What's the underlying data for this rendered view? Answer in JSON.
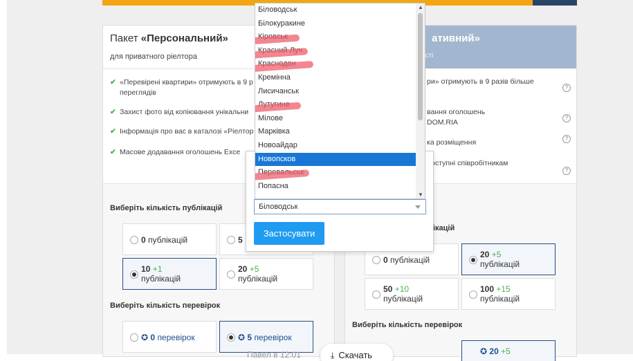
{
  "left_card": {
    "title_prefix": "Пакет ",
    "title_bold": "«Персональний»",
    "subtitle": "для приватного ріелтора",
    "features": [
      "«Перевірені квартири» отримують в 9 р",
      "переглядів",
      "Захист фото від копіювання унікальни",
      "Інформація про вас в каталозі «Ріелтор",
      "Масове додавання оголошень Exce"
    ],
    "publications_label": "Виберіть кількість публікацій",
    "publication_options": [
      {
        "num": "0",
        "text": "публікацій",
        "plus": ""
      },
      {
        "num": "5",
        "text": "",
        "plus": ""
      },
      {
        "num": "10",
        "text": "публікацій",
        "plus": "+1"
      },
      {
        "num": "20",
        "text": "публікацій",
        "plus": "+5"
      }
    ],
    "checks_label": "Виберіть кількість перевірок",
    "check_options": [
      {
        "num": "0",
        "text": "перевірок"
      },
      {
        "num": "5",
        "text": "перевірок"
      }
    ]
  },
  "right_card": {
    "title": "ативний»",
    "subtitle": "ості",
    "features": [
      "ри» отримують в 9 разів більше",
      "вання оголошень",
      "DOM.RIA",
      "ка розміщення",
      "доступні співробітникам"
    ],
    "publications_label": "лікацій",
    "publication_options": [
      {
        "num": "0",
        "text": "публікацій",
        "plus": ""
      },
      {
        "num": "20",
        "text": "публікацій",
        "plus": "+5"
      },
      {
        "num": "50",
        "text": "публікацій",
        "plus": "+10"
      },
      {
        "num": "100",
        "text": "публікацій",
        "plus": "+15"
      }
    ],
    "checks_label": "Виберіть кількість перевірок",
    "check_option_partial": {
      "num": "20",
      "plus": "+5"
    }
  },
  "dropdown": {
    "items": [
      "Біловодськ",
      "Білокуракине",
      "Кіровськ",
      "Красний Луч",
      "Краснодон",
      "Кремінна",
      "Лисичанськ",
      "Лутугине",
      "Мілове",
      "Марківка",
      "Новоайдар",
      "Новопсков",
      "Перевальськ",
      "Попасна"
    ],
    "highlighted_index": 11,
    "struck_indices": [
      2,
      3,
      4,
      7,
      12
    ]
  },
  "modal": {
    "selected_value": "Біловодськ",
    "apply_label": "Застосувати"
  },
  "footer": {
    "author": "Павел в 12:01",
    "download_label": "Скачать"
  },
  "colors": {
    "accent_orange": "#f3a512",
    "button_blue": "#1f9cf0",
    "highlight_blue": "#1877d4",
    "strike_red": "#ee5f6e",
    "check_green": "#4caf50"
  }
}
